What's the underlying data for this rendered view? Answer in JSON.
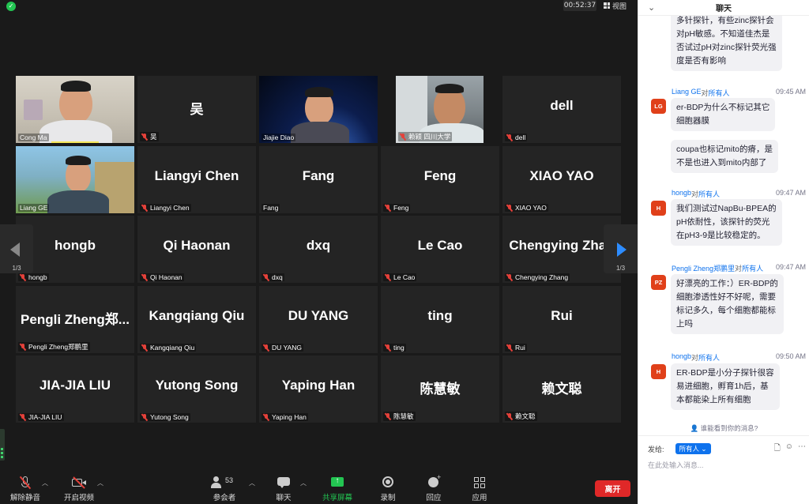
{
  "top_bar": {
    "timer": "00:52:37",
    "view_label": "视图"
  },
  "pager": {
    "left_label": "1/3",
    "right_label": "1/3"
  },
  "participants": [
    {
      "id": "cong-ma",
      "name": "Cong Ma",
      "big": "",
      "video": true,
      "muted": false
    },
    {
      "id": "wu",
      "name": "吴",
      "big": "吴",
      "video": false,
      "muted": true
    },
    {
      "id": "jiajie-diao",
      "name": "Jiajie Diao",
      "big": "",
      "video": true,
      "muted": false
    },
    {
      "id": "lai-ying",
      "name": "赖颖 四川大学",
      "big": "",
      "video": true,
      "muted": true
    },
    {
      "id": "dell",
      "name": "dell",
      "big": "dell",
      "video": false,
      "muted": true
    },
    {
      "id": "liang-ge",
      "name": "Liang GE",
      "big": "",
      "video": true,
      "muted": false
    },
    {
      "id": "liangyi-chen",
      "name": "Liangyi Chen",
      "big": "Liangyi Chen",
      "video": false,
      "muted": true
    },
    {
      "id": "fang",
      "name": "Fang",
      "big": "Fang",
      "video": false,
      "muted": false
    },
    {
      "id": "feng",
      "name": "Feng",
      "big": "Feng",
      "video": false,
      "muted": true
    },
    {
      "id": "xiao-yao",
      "name": "XIAO YAO",
      "big": "XIAO YAO",
      "video": false,
      "muted": true
    },
    {
      "id": "hongb",
      "name": "hongb",
      "big": "hongb",
      "video": false,
      "muted": true
    },
    {
      "id": "qi-haonan",
      "name": "Qi Haonan",
      "big": "Qi Haonan",
      "video": false,
      "muted": true
    },
    {
      "id": "dxq",
      "name": "dxq",
      "big": "dxq",
      "video": false,
      "muted": true
    },
    {
      "id": "le-cao",
      "name": "Le Cao",
      "big": "Le Cao",
      "video": false,
      "muted": true
    },
    {
      "id": "chengying-zhang",
      "name": "Chengying Zhang",
      "big": "Chengying Zhan",
      "video": false,
      "muted": true
    },
    {
      "id": "pengli-zheng",
      "name": "Pengli Zheng郑鹏里",
      "big": "Pengli  Zheng郑...",
      "video": false,
      "muted": true
    },
    {
      "id": "kangqiang-qiu",
      "name": "Kangqiang Qiu",
      "big": "Kangqiang Qiu",
      "video": false,
      "muted": true
    },
    {
      "id": "du-yang",
      "name": "DU YANG",
      "big": "DU YANG",
      "video": false,
      "muted": true
    },
    {
      "id": "ting",
      "name": "ting",
      "big": "ting",
      "video": false,
      "muted": true
    },
    {
      "id": "rui",
      "name": "Rui",
      "big": "Rui",
      "video": false,
      "muted": true
    },
    {
      "id": "jia-jia-liu",
      "name": "JIA-JIA LIU",
      "big": "JIA-JIA LIU",
      "video": false,
      "muted": true
    },
    {
      "id": "yutong-song",
      "name": "Yutong Song",
      "big": "Yutong Song",
      "video": false,
      "muted": true
    },
    {
      "id": "yaping-han",
      "name": "Yaping Han",
      "big": "Yaping Han",
      "video": false,
      "muted": true
    },
    {
      "id": "chen-huimin",
      "name": "陈慧敏",
      "big": "陈慧敏",
      "video": false,
      "muted": true
    },
    {
      "id": "lai-wencong",
      "name": "赖文聪",
      "big": "赖文聪",
      "video": false,
      "muted": true
    }
  ],
  "toolbar": {
    "unmute": "解除静音",
    "start_video": "开启视频",
    "participants": "参会者",
    "participants_count": "53",
    "chat": "聊天",
    "share": "共享屏幕",
    "record": "录制",
    "reactions": "回应",
    "apps": "应用",
    "leave": "离开"
  },
  "chat": {
    "title": "聊天",
    "messages": [
      {
        "id": "m0",
        "avatar": "",
        "sender": "",
        "to_label": "",
        "recipient": "",
        "time": "",
        "lines": [
          "多针探针，有些zinc探针会",
          "对pH敏感。不知道佳杰是",
          "否试过pH对zinc探针荧光强",
          "度是否有影响"
        ]
      },
      {
        "id": "m1",
        "avatar": "LG",
        "sender": "Liang GE",
        "to_label": "对",
        "recipient": "所有人",
        "time": "09:45 AM",
        "lines": [
          "er-BDP为什么不标记其它",
          "细胞器膜"
        ]
      },
      {
        "id": "m2",
        "avatar": "",
        "sender": "",
        "to_label": "",
        "recipient": "",
        "time": "",
        "lines": [
          "coupa也标记mito的瘠，是",
          "不是也进入到mito内部了"
        ]
      },
      {
        "id": "m3",
        "avatar": "H",
        "sender": "hongb",
        "to_label": "对",
        "recipient": "所有人",
        "time": "09:47 AM",
        "lines": [
          "我们测试过NapBu-BPEA的",
          "pH依耐性，该探针的荧光",
          "在pH3-9是比较稳定的。"
        ]
      },
      {
        "id": "m4",
        "avatar": "PZ",
        "sender": "Pengli Zheng郑鹏里",
        "to_label": "对",
        "recipient": "所有人",
        "time": "09:47 AM",
        "lines": [
          "好漂亮的工作：）ER-BDP的",
          "细胞渗透性好不好呢，需要",
          "标记多久，每个细胞都能标",
          "上吗"
        ]
      },
      {
        "id": "m5",
        "avatar": "H",
        "sender": "hongb",
        "to_label": "对",
        "recipient": "所有人",
        "time": "09:50 AM",
        "lines": [
          "ER-BDP是小分子探针很容",
          "易进细胞，孵育1h后，基",
          "本都能染上所有细胞"
        ]
      }
    ],
    "who_sees": "谁能看到你的消息?",
    "send_to_label": "发给:",
    "send_to_value": "所有人",
    "input_placeholder": "在此处输入消息..."
  },
  "colors": {
    "accent": "#0e72ed",
    "leave": "#e02828",
    "share": "#23c552",
    "muted": "#e5413a",
    "avatar": "#e0401a"
  }
}
